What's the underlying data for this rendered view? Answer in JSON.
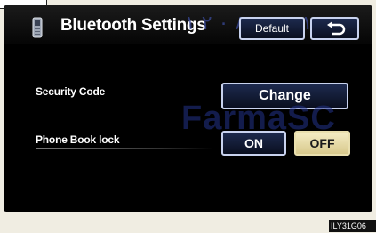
{
  "header": {
    "title": "Bluetooth Settings",
    "title_icon": "phone-icon",
    "default_label": "Default",
    "back_icon": "back-arrow-icon"
  },
  "settings": [
    {
      "label": "Security Code",
      "action_label": "Change"
    },
    {
      "label": "Phone Book lock",
      "on_label": "ON",
      "off_label": "OFF",
      "selected": "OFF"
    }
  ],
  "watermark": {
    "top_text": "۱ ۲ ۰ ۸ ۰ ۸ ۲ ۱",
    "main_text": "FarmaSC"
  },
  "figure_code": "ILY31G06"
}
